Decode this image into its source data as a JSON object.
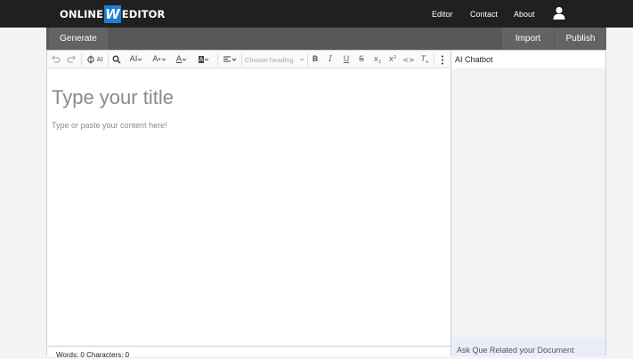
{
  "brand": {
    "part1": "ONLINE",
    "part2": "W",
    "part3": "EDITOR",
    "accent_color": "#1a7fd6"
  },
  "nav": {
    "links": [
      "Editor",
      "Contact",
      "About"
    ],
    "user_icon": "user-icon"
  },
  "actions": {
    "generate": "Generate",
    "import": "Import",
    "publish": "Publish"
  },
  "toolbar": {
    "undo": "undo-icon",
    "redo": "redo-icon",
    "ai_label": "AI",
    "find": "find-replace-icon",
    "font_size_label": "AI",
    "font_family_label": "A",
    "font_color_label": "A",
    "bg_color_label": "A",
    "align": "align-icon",
    "heading_placeholder": "Choose heading",
    "bold": "B",
    "italic": "I",
    "underline": "U",
    "strike": "S",
    "subscript": "x",
    "superscript": "x",
    "code": "<>",
    "clear": "T",
    "more": "more-icon"
  },
  "editor": {
    "title_placeholder": "Type your title",
    "content_placeholder": "Type or paste your content here!"
  },
  "footer": {
    "stats": "Words: 0   Characters: 0"
  },
  "chat": {
    "title": "AI Chatbot",
    "input_placeholder": "Ask Que Related your Document"
  }
}
